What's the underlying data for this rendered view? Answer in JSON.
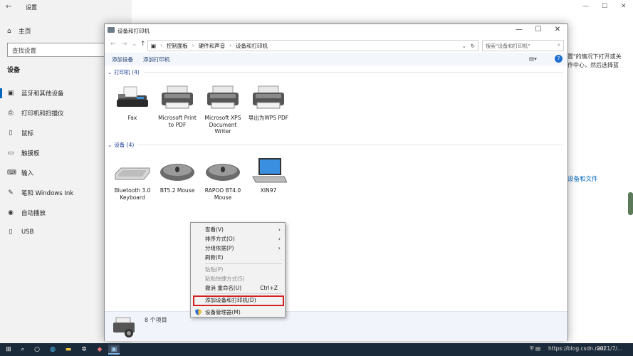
{
  "settings": {
    "title": "设置",
    "home_label": "主页",
    "search_placeholder": "查找设置",
    "section": "设备",
    "items": [
      {
        "label": "蓝牙和其他设备",
        "icon": "bluetooth-icon"
      },
      {
        "label": "打印机和扫描仪",
        "icon": "printer-icon"
      },
      {
        "label": "鼠标",
        "icon": "mouse-icon"
      },
      {
        "label": "触摸板",
        "icon": "touchpad-icon"
      },
      {
        "label": "输入",
        "icon": "keyboard-icon"
      },
      {
        "label": "笔和 Windows Ink",
        "icon": "pen-icon"
      },
      {
        "label": "自动播放",
        "icon": "autoplay-icon"
      },
      {
        "label": "USB",
        "icon": "usb-icon"
      }
    ],
    "right_text_1": "置\"的情况下打开或关",
    "right_text_2": "作中心，然后选择蓝",
    "right_link": "设备和文件"
  },
  "window": {
    "title": "设备和打印机",
    "breadcrumb": [
      "控制面板",
      "硬件和声音",
      "设备和打印机"
    ],
    "search_placeholder": "搜索\"设备和打印机\"",
    "commands": {
      "add_device": "添加设备",
      "add_printer": "添加打印机"
    },
    "printers_header": "打印机 (4)",
    "devices_header": "设备 (4)",
    "printers": [
      {
        "name": "Fax",
        "icon": "fax-icon"
      },
      {
        "name": "Microsoft Print to PDF",
        "icon": "printer-icon"
      },
      {
        "name": "Microsoft XPS Document Writer",
        "icon": "printer-icon"
      },
      {
        "name": "导出为WPS PDF",
        "icon": "printer-icon"
      }
    ],
    "devices": [
      {
        "name": "Bluetooth 3.0 Keyboard",
        "icon": "keyboard-icon"
      },
      {
        "name": "BT5.2 Mouse",
        "icon": "mouse-icon"
      },
      {
        "name": "RAPOO BT4.0 Mouse",
        "icon": "mouse-icon"
      },
      {
        "name": "XIN97",
        "icon": "laptop-icon"
      }
    ],
    "status_count": "8 个项目"
  },
  "context_menu": {
    "items": [
      {
        "label": "查看(V)",
        "submenu": true,
        "disabled": false
      },
      {
        "label": "排序方式(O)",
        "submenu": true,
        "disabled": false
      },
      {
        "label": "分组依据(P)",
        "submenu": true,
        "disabled": false
      },
      {
        "label": "刷新(E)",
        "submenu": false,
        "disabled": false
      },
      {
        "label": "粘贴(P)",
        "submenu": false,
        "disabled": true
      },
      {
        "label": "粘贴快捷方式(S)",
        "submenu": false,
        "disabled": true
      },
      {
        "label": "撤消 重命名(U)",
        "shortcut": "Ctrl+Z",
        "disabled": false
      },
      {
        "label": "添加设备和打印机(D)",
        "highlighted": true,
        "disabled": false
      },
      {
        "label": "设备管理器(M)",
        "icon": "shield-icon",
        "disabled": false
      }
    ],
    "highlight_color": "#d42020"
  },
  "taskbar": {
    "tray_text": "https://blog.csdn.net/...",
    "clock": "2021/7/..."
  },
  "colors": {
    "accent": "#0067c0",
    "link": "#1e3f9a",
    "taskbar": "#1b2a3a"
  }
}
